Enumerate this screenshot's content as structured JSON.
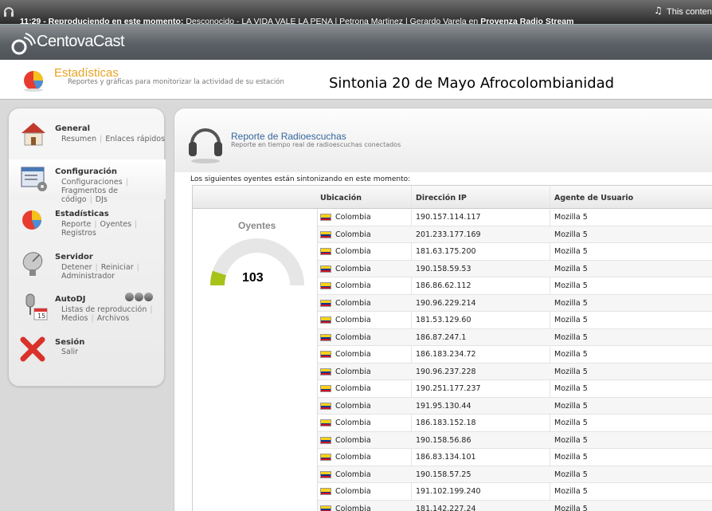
{
  "ticker": {
    "prefix": "11:29 - Reproduciendo en este momento:",
    "song": "Desconocido - LA VIDA VALE LA PENA | Petrona Martinez | Gerardo Varela",
    "on": "en",
    "station": "Provenza Radio Stream",
    "right_note": "This content n"
  },
  "header": {
    "logo_text": "CentovaCast"
  },
  "section": {
    "title": "Estadísticas",
    "subtitle": "Reportes y gráficas para monitorizar la actividad de su estación",
    "overlay_text": "Sintonia 20 de Mayo Afrocolombianidad"
  },
  "sidebar": {
    "general": {
      "title": "General",
      "links": [
        "Resumen",
        "Enlaces rápidos"
      ]
    },
    "configuracion": {
      "title": "Configuración",
      "links": [
        "Configuraciones",
        "Fragmentos de código",
        "DJs"
      ]
    },
    "estadisticas": {
      "title": "Estadísticas",
      "links": [
        "Reporte",
        "Oyentes",
        "Registros"
      ]
    },
    "servidor": {
      "title": "Servidor",
      "links": [
        "Detener",
        "Reiniciar",
        "Administrador"
      ]
    },
    "autodj": {
      "title": "AutoDJ",
      "links": [
        "Listas de reproducción",
        "Medios",
        "Archivos"
      ]
    },
    "sesion": {
      "title": "Sesión",
      "links": [
        "Salir"
      ]
    }
  },
  "report": {
    "title": "Reporte de Radioescuchas",
    "subtitle": "Reporte en tiempo real de radioescuchas conectados",
    "intro": "Los siguientes oyentes están sintonizando en este momento:",
    "columns": {
      "location": "Ubicación",
      "ip": "Dirección IP",
      "ua": "Agente de Usuario"
    },
    "gauge_label": "Oyentes",
    "gauge_value": "103",
    "gauge_fraction": 0.1,
    "flag_colors": [
      "#fcd116",
      "#003893",
      "#ce1126"
    ],
    "listeners": [
      {
        "country": "Colombia",
        "ip": "190.157.114.117",
        "ua": "Mozilla 5"
      },
      {
        "country": "Colombia",
        "ip": "201.233.177.169",
        "ua": "Mozilla 5"
      },
      {
        "country": "Colombia",
        "ip": "181.63.175.200",
        "ua": "Mozilla 5"
      },
      {
        "country": "Colombia",
        "ip": "190.158.59.53",
        "ua": "Mozilla 5"
      },
      {
        "country": "Colombia",
        "ip": "186.86.62.112",
        "ua": "Mozilla 5"
      },
      {
        "country": "Colombia",
        "ip": "190.96.229.214",
        "ua": "Mozilla 5"
      },
      {
        "country": "Colombia",
        "ip": "181.53.129.60",
        "ua": "Mozilla 5"
      },
      {
        "country": "Colombia",
        "ip": "186.87.247.1",
        "ua": "Mozilla 5"
      },
      {
        "country": "Colombia",
        "ip": "186.183.234.72",
        "ua": "Mozilla 5"
      },
      {
        "country": "Colombia",
        "ip": "190.96.237.228",
        "ua": "Mozilla 5"
      },
      {
        "country": "Colombia",
        "ip": "190.251.177.237",
        "ua": "Mozilla 5"
      },
      {
        "country": "Colombia",
        "ip": "191.95.130.44",
        "ua": "Mozilla 5"
      },
      {
        "country": "Colombia",
        "ip": "186.183.152.18",
        "ua": "Mozilla 5"
      },
      {
        "country": "Colombia",
        "ip": "190.158.56.86",
        "ua": "Mozilla 5"
      },
      {
        "country": "Colombia",
        "ip": "186.83.134.101",
        "ua": "Mozilla 5"
      },
      {
        "country": "Colombia",
        "ip": "190.158.57.25",
        "ua": "Mozilla 5"
      },
      {
        "country": "Colombia",
        "ip": "191.102.199.240",
        "ua": "Mozilla 5"
      },
      {
        "country": "Colombia",
        "ip": "181.142.227.24",
        "ua": "Mozilla 5"
      }
    ]
  }
}
